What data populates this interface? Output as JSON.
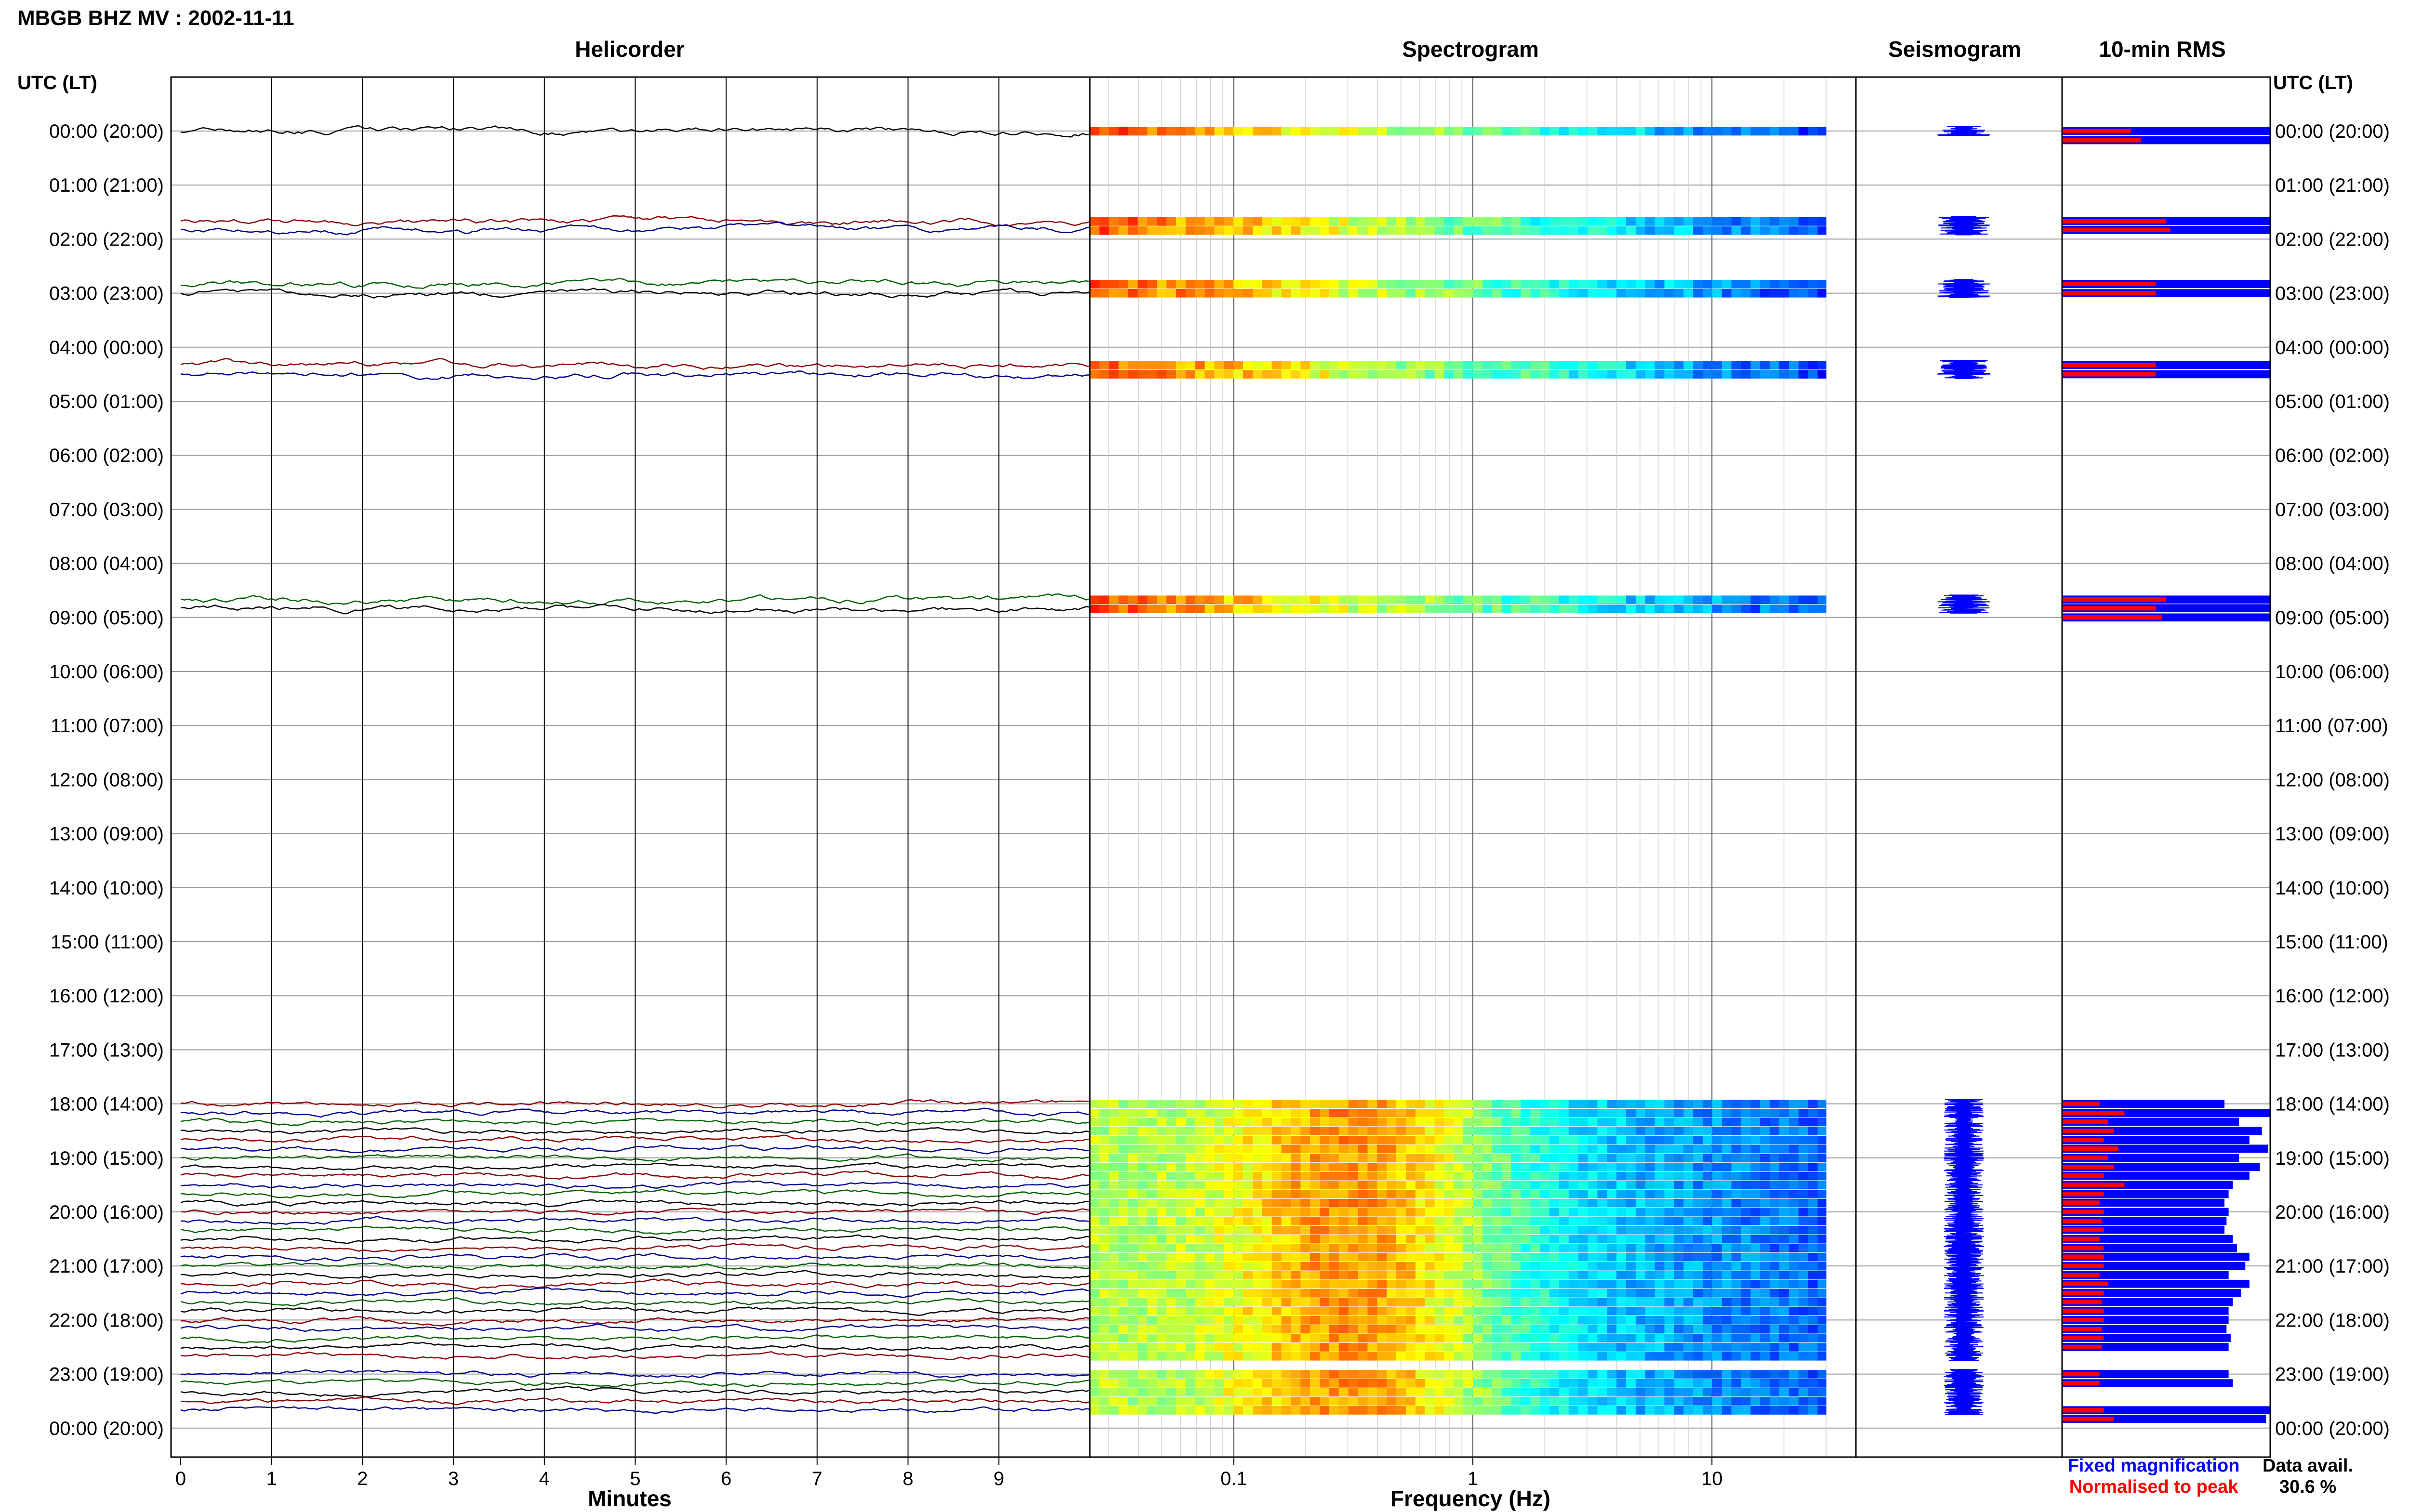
{
  "title": "MBGB BHZ MV : 2002-11-11",
  "panels": {
    "helicorder": "Helicorder",
    "spectrogram": "Spectrogram",
    "seismogram": "Seismogram",
    "rms": "10-min RMS"
  },
  "time_axis_label_left": "UTC (LT)",
  "time_axis_label_right": "UTC (LT)",
  "hour_labels": [
    "00:00 (20:00)",
    "01:00 (21:00)",
    "02:00 (22:00)",
    "03:00 (23:00)",
    "04:00 (00:00)",
    "05:00 (01:00)",
    "06:00 (02:00)",
    "07:00 (03:00)",
    "08:00 (04:00)",
    "09:00 (05:00)",
    "10:00 (06:00)",
    "11:00 (07:00)",
    "12:00 (08:00)",
    "13:00 (09:00)",
    "14:00 (10:00)",
    "15:00 (11:00)",
    "16:00 (12:00)",
    "17:00 (13:00)",
    "18:00 (14:00)",
    "19:00 (15:00)",
    "20:00 (16:00)",
    "21:00 (17:00)",
    "22:00 (18:00)",
    "23:00 (19:00)",
    "00:00 (20:00)"
  ],
  "legend": {
    "fixed": "Fixed magnification",
    "normalised": "Normalised to peak"
  },
  "data_availability": {
    "label": "Data avail.",
    "value": "30.6 %"
  },
  "colors": {
    "helicorder_traces": [
      "#000000",
      "#8b0000",
      "#00008b",
      "#006400"
    ],
    "rms_fixed": "#0000ff",
    "rms_normalised": "#ff0000",
    "legend_fixed": "#0000ff",
    "legend_normalised": "#ff0000"
  },
  "chart_data": [
    {
      "type": "line",
      "panel": "Helicorder",
      "xlabel": "Minutes",
      "xlim": [
        0,
        10
      ],
      "x_ticks": [
        "0",
        "1",
        "2",
        "3",
        "4",
        "5",
        "6",
        "7",
        "8",
        "9"
      ],
      "ylim": [
        "00:00",
        "00:00"
      ],
      "segments_with_data_hours": [
        [
          0,
          0
        ],
        [
          1.67,
          2.0
        ],
        [
          2.83,
          3.0
        ],
        [
          4.33,
          4.5
        ],
        [
          8.67,
          9.0
        ],
        [
          18.0,
          22.67
        ],
        [
          23.0,
          23.67
        ]
      ],
      "row_interval_minutes": 10
    },
    {
      "type": "heatmap",
      "panel": "Spectrogram",
      "xlabel": "Frequency (Hz)",
      "x_scale": "log",
      "xlim": [
        0.025,
        40
      ],
      "x_ticks": [
        "0.1",
        "1",
        "10"
      ],
      "segments_with_data_hours": [
        [
          0,
          0
        ],
        [
          1.67,
          2.0
        ],
        [
          2.83,
          3.0
        ],
        [
          4.33,
          4.5
        ],
        [
          8.67,
          9.0
        ],
        [
          18.0,
          22.67
        ],
        [
          23.0,
          23.67
        ]
      ]
    },
    {
      "type": "line",
      "panel": "Seismogram",
      "segments_with_data_hours": [
        [
          0,
          0
        ],
        [
          1.67,
          2.0
        ],
        [
          2.83,
          3.0
        ],
        [
          4.33,
          4.5
        ],
        [
          8.67,
          9.0
        ],
        [
          18.0,
          22.67
        ],
        [
          23.0,
          23.67
        ]
      ]
    },
    {
      "type": "bar",
      "panel": "10-min RMS",
      "orientation": "horizontal",
      "series": [
        {
          "name": "Fixed magnification",
          "points": [
            [
              0.0,
              1.0
            ],
            [
              0.17,
              1.0
            ],
            [
              1.67,
              1.0
            ],
            [
              1.83,
              1.0
            ],
            [
              2.83,
              1.0
            ],
            [
              3.0,
              1.0
            ],
            [
              4.33,
              1.0
            ],
            [
              4.5,
              1.0
            ],
            [
              8.67,
              1.0
            ],
            [
              8.83,
              1.0
            ],
            [
              9.0,
              1.0
            ],
            [
              18.0,
              0.78
            ],
            [
              18.17,
              1.0
            ],
            [
              18.33,
              0.85
            ],
            [
              18.5,
              0.96
            ],
            [
              18.67,
              0.9
            ],
            [
              18.83,
              0.99
            ],
            [
              19.0,
              0.85
            ],
            [
              19.17,
              0.95
            ],
            [
              19.33,
              0.9
            ],
            [
              19.5,
              0.82
            ],
            [
              19.67,
              0.8
            ],
            [
              19.83,
              0.78
            ],
            [
              20.0,
              0.8
            ],
            [
              20.17,
              0.79
            ],
            [
              20.33,
              0.78
            ],
            [
              20.5,
              0.82
            ],
            [
              20.67,
              0.84
            ],
            [
              20.83,
              0.9
            ],
            [
              21.0,
              0.88
            ],
            [
              21.17,
              0.8
            ],
            [
              21.33,
              0.9
            ],
            [
              21.5,
              0.86
            ],
            [
              21.67,
              0.82
            ],
            [
              21.83,
              0.8
            ],
            [
              22.0,
              0.8
            ],
            [
              22.17,
              0.79
            ],
            [
              22.33,
              0.81
            ],
            [
              22.5,
              0.8
            ],
            [
              23.0,
              0.8
            ],
            [
              23.17,
              0.82
            ],
            [
              23.67,
              1.0
            ],
            [
              23.83,
              0.98
            ]
          ]
        },
        {
          "name": "Normalised to peak",
          "points": [
            [
              0.0,
              0.33
            ],
            [
              0.17,
              0.38
            ],
            [
              1.67,
              0.5
            ],
            [
              1.83,
              0.52
            ],
            [
              2.83,
              0.45
            ],
            [
              3.0,
              0.45
            ],
            [
              4.33,
              0.45
            ],
            [
              4.5,
              0.45
            ],
            [
              8.67,
              0.5
            ],
            [
              8.83,
              0.45
            ],
            [
              9.0,
              0.48
            ],
            [
              18.0,
              0.18
            ],
            [
              18.17,
              0.3
            ],
            [
              18.33,
              0.22
            ],
            [
              18.5,
              0.25
            ],
            [
              18.67,
              0.2
            ],
            [
              18.83,
              0.27
            ],
            [
              19.0,
              0.22
            ],
            [
              19.17,
              0.25
            ],
            [
              19.33,
              0.2
            ],
            [
              19.5,
              0.3
            ],
            [
              19.67,
              0.2
            ],
            [
              19.83,
              0.18
            ],
            [
              20.0,
              0.2
            ],
            [
              20.17,
              0.19
            ],
            [
              20.33,
              0.2
            ],
            [
              20.5,
              0.18
            ],
            [
              20.67,
              0.2
            ],
            [
              20.83,
              0.2
            ],
            [
              21.0,
              0.2
            ],
            [
              21.17,
              0.18
            ],
            [
              21.33,
              0.22
            ],
            [
              21.5,
              0.2
            ],
            [
              21.67,
              0.19
            ],
            [
              21.83,
              0.2
            ],
            [
              22.0,
              0.2
            ],
            [
              22.17,
              0.19
            ],
            [
              22.33,
              0.2
            ],
            [
              22.5,
              0.19
            ],
            [
              23.0,
              0.18
            ],
            [
              23.17,
              0.18
            ],
            [
              23.67,
              0.2
            ],
            [
              23.83,
              0.25
            ]
          ]
        }
      ]
    }
  ]
}
